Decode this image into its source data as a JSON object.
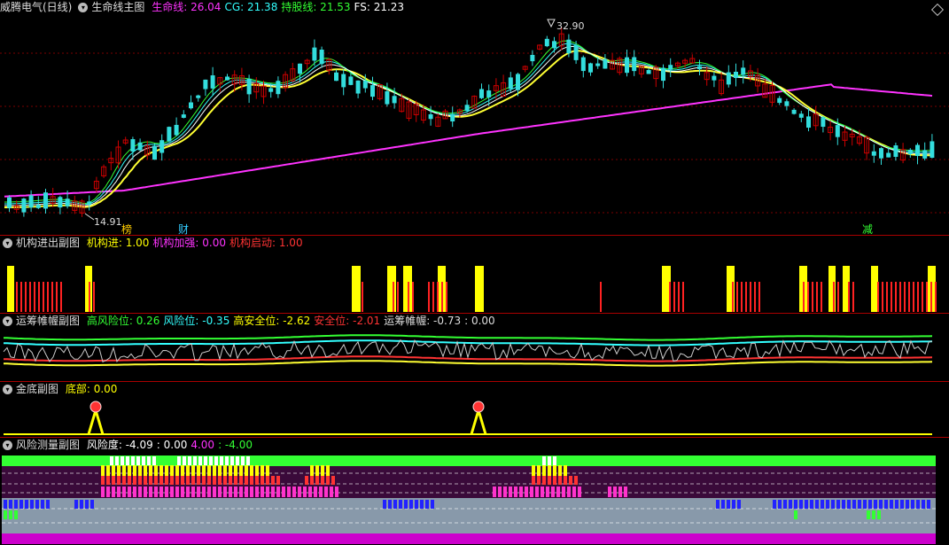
{
  "main": {
    "stock": "威腾电气(日线)",
    "indicator": "生命线主图",
    "values": [
      {
        "label": "生命线:",
        "value": "26.04",
        "color": "#ff33ff"
      },
      {
        "label": "CG:",
        "value": "21.38",
        "color": "#33ffff"
      },
      {
        "label": "持股线:",
        "value": "21.53",
        "color": "#33ff33"
      },
      {
        "label": "FS:",
        "value": "21.23",
        "color": "#ffffff"
      }
    ],
    "high_label": "32.90",
    "low_label": "14.91",
    "markers": [
      {
        "text": "榜",
        "color": "#ffcc00"
      },
      {
        "text": "财",
        "color": "#33ccff"
      },
      {
        "text": "减",
        "color": "#33ff33"
      }
    ]
  },
  "sub1": {
    "title": "机构进出副图",
    "values": [
      {
        "label": "机构进:",
        "value": "1.00",
        "color": "#ffff00"
      },
      {
        "label": "机构加强:",
        "value": "0.00",
        "color": "#ff33ff"
      },
      {
        "label": "机构启动:",
        "value": "1.00",
        "color": "#ff3333"
      }
    ]
  },
  "sub2": {
    "title": "运筹帷幄副图",
    "values": [
      {
        "label": "高风险位:",
        "value": "0.26",
        "color": "#33ff33"
      },
      {
        "label": "风险位:",
        "value": "-0.35",
        "color": "#33ffff"
      },
      {
        "label": "高安全位:",
        "value": "-2.62",
        "color": "#ffff00"
      },
      {
        "label": "安全位:",
        "value": "-2.01",
        "color": "#ff3333"
      },
      {
        "label": "运筹帷幄:",
        "value": "-0.73",
        "color": "#dddddd"
      },
      {
        "label": ":",
        "value": "0.00",
        "color": "#dddddd"
      }
    ]
  },
  "sub3": {
    "title": "金底副图",
    "values": [
      {
        "label": "底部:",
        "value": "0.00",
        "color": "#ffff00"
      }
    ]
  },
  "sub4": {
    "title": "风险测量副图",
    "values": [
      {
        "label": "风险度:",
        "value": "-4.09",
        "color": "#ffffff"
      },
      {
        "label": ":",
        "value": "0.00",
        "color": "#ffffff"
      },
      {
        "label": "",
        "value": "4.00",
        "color": "#ff33ff"
      },
      {
        "label": ":",
        "value": "-4.00",
        "color": "#33ff33"
      }
    ]
  }
}
